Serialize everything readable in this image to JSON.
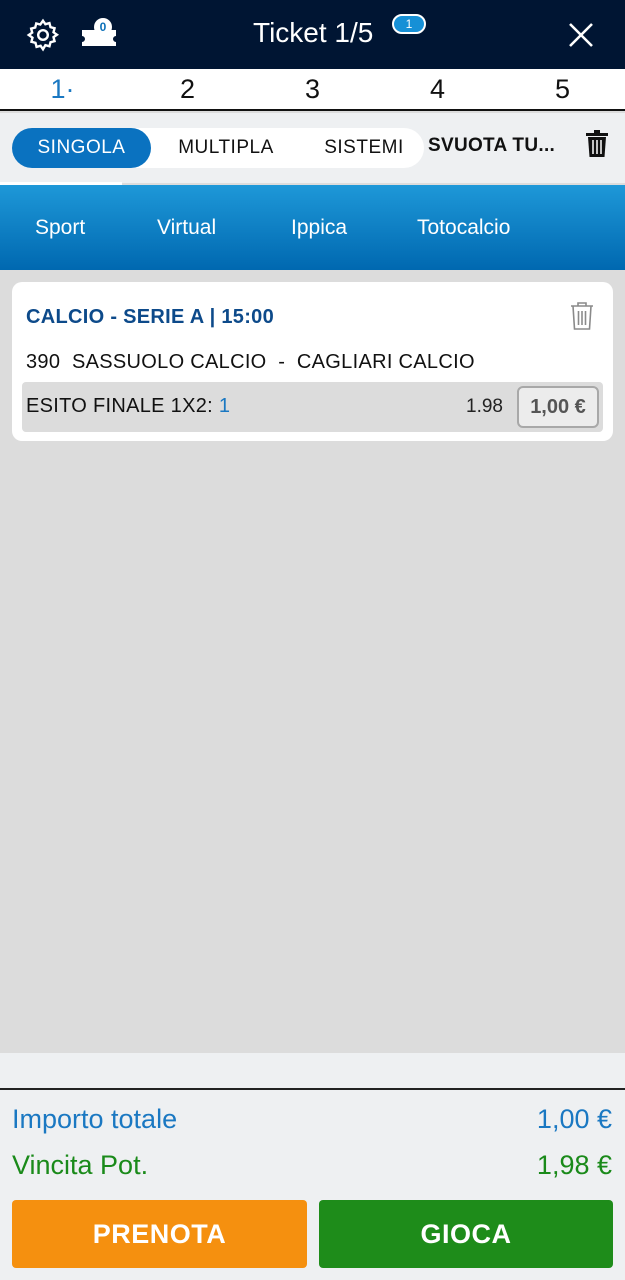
{
  "header": {
    "settings_icon": "gear-icon",
    "ticket_count": "0",
    "title": "Ticket 1/5",
    "title_badge": "1",
    "close_icon": "close-icon",
    "background_color": "#001533"
  },
  "ticket_tabs": [
    {
      "label": "1·",
      "active": true
    },
    {
      "label": "2",
      "active": false
    },
    {
      "label": "3",
      "active": false
    },
    {
      "label": "4",
      "active": false
    },
    {
      "label": "5",
      "active": false
    }
  ],
  "mode": {
    "options": [
      "SINGOLA",
      "MULTIPLA",
      "SISTEMI"
    ],
    "selected": "SINGOLA",
    "clear_label": "SVUOTA TU...",
    "accent_color": "#0a72c0"
  },
  "categories": [
    "Sport",
    "Virtual",
    "Ippica",
    "Totocalcio"
  ],
  "bet": {
    "league": "CALCIO - SERIE A | 15:00",
    "match": "390  SASSUOLO CALCIO  -  CAGLIARI CALCIO",
    "market": "ESITO FINALE 1X2: ",
    "pick": "1",
    "odd": "1.98",
    "stake": "1,00 €"
  },
  "footer": {
    "total_label": "Importo totale",
    "total_value": "1,00 €",
    "win_label": "Vincita Pot.",
    "win_value": "1,98 €",
    "prenota_label": "PRENOTA",
    "gioca_label": "GIOCA",
    "prenota_color": "#f5900f",
    "gioca_color": "#1e8c1a"
  }
}
